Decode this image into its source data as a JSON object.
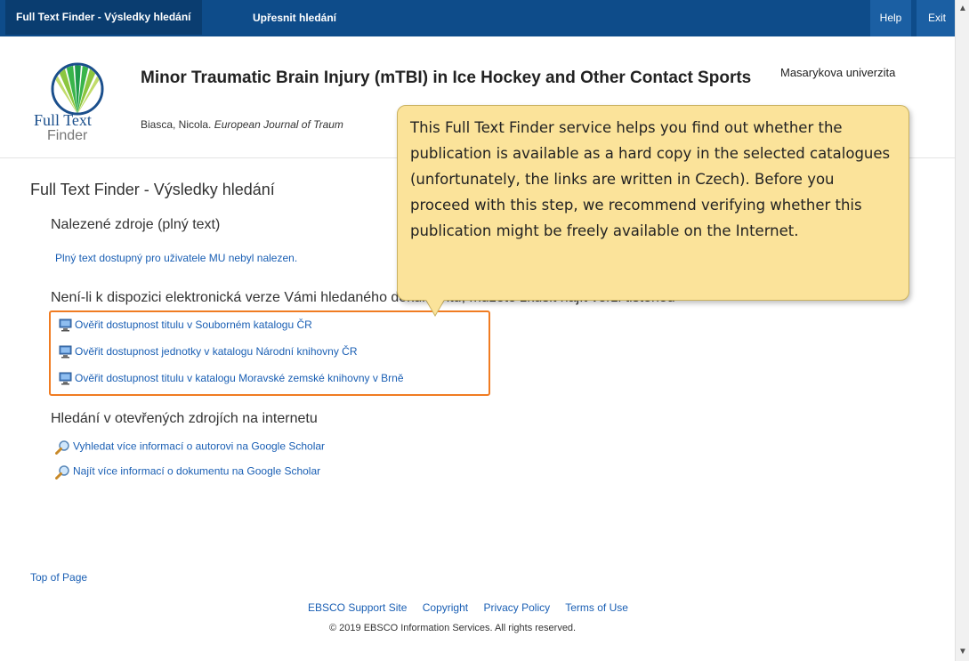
{
  "topbar": {
    "tab_results": "Full Text Finder - Výsledky hledání",
    "tab_refine": "Upřesnit hledání",
    "help": "Help",
    "exit": "Exit"
  },
  "header": {
    "logo_line1": "Full Text",
    "logo_line2": "Finder",
    "article_title": "Minor Traumatic Brain Injury (mTBI) in Ice Hockey and Other Contact Sports",
    "author": "Biasca, Nicola.",
    "journal": "European Journal of Traum",
    "institution": "Masarykova univerzita"
  },
  "main": {
    "title": "Full Text Finder - Výsledky hledání",
    "found_heading": "Nalezené zdroje (plný text)",
    "not_found_text": "Plný text dostupný pro uživatele MU nebyl nalezen.",
    "print_heading": "Není-li k dispozici elektronická verze Vámi hledaného dokumentu, můžete zkusit najít verzi tištěnou",
    "catalog_links": [
      "Ověřit dostupnost titulu v Souborném katalogu ČR",
      "Ověřit dostupnost jednotky v katalogu Národní knihovny ČR",
      "Ověřit dostupnost titulu v katalogu Moravské zemské knihovny v Brně"
    ],
    "open_heading": "Hledání v otevřených zdrojích na internetu",
    "scholar_links": [
      "Vyhledat více informací o autorovi na Google Scholar",
      "Najít více informací o dokumentu na Google Scholar"
    ]
  },
  "tooltip": {
    "text": "This Full Text Finder service helps you find out whether the publication is available as a hard copy in the selected catalogues (unfortunately, the links are written in Czech). Before you proceed with this step, we recommend verifying whether this publication might be freely available on the Internet."
  },
  "footer": {
    "top_of_page": "Top of Page",
    "links": [
      "EBSCO Support Site",
      "Copyright",
      "Privacy Policy",
      "Terms of Use"
    ],
    "copyright": "© 2019 EBSCO Information Services. All rights reserved."
  },
  "colors": {
    "topbar": "#0e4c8a",
    "link": "#1a5fb4",
    "highlight": "#f07c22",
    "tooltip_bg": "#fbe39a"
  },
  "icons": [
    "monitor-icon",
    "magnifier-icon",
    "full-text-finder-logo"
  ]
}
